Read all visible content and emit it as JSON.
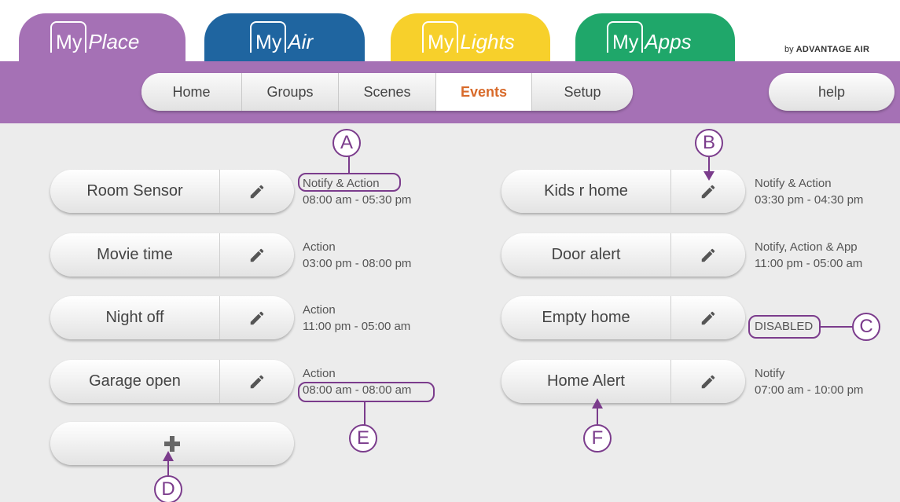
{
  "colors": {
    "myplace": "#a571b5",
    "myair": "#1f65a0",
    "mylights": "#f7d02b",
    "myapps": "#1fa76a",
    "active_tab_text": "#d86a2a",
    "annotation": "#7b3c8c"
  },
  "app_tabs": [
    {
      "prefix": "My",
      "name": "Place"
    },
    {
      "prefix": "My",
      "name": "Air"
    },
    {
      "prefix": "My",
      "name": "Lights"
    },
    {
      "prefix": "My",
      "name": "Apps"
    }
  ],
  "brand": {
    "by": "by",
    "name": "ADVANTAGE AIR"
  },
  "nav": {
    "tabs": [
      "Home",
      "Groups",
      "Scenes",
      "Events",
      "Setup"
    ],
    "active": "Events",
    "help": "help"
  },
  "events_left": [
    {
      "name": "Room Sensor",
      "type": "Notify & Action",
      "time": "08:00 am - 05:30 pm"
    },
    {
      "name": "Movie time",
      "type": "Action",
      "time": "03:00 pm - 08:00 pm"
    },
    {
      "name": "Night off",
      "type": "Action",
      "time": "11:00 pm - 05:00 am"
    },
    {
      "name": "Garage open",
      "type": "Action",
      "time": "08:00 am - 08:00 am"
    }
  ],
  "events_right": [
    {
      "name": "Kids r home",
      "type": "Notify & Action",
      "time": "03:30 pm - 04:30 pm"
    },
    {
      "name": "Door alert",
      "type": "Notify, Action & App",
      "time": "11:00 pm - 05:00 am"
    },
    {
      "name": "Empty home",
      "type": "DISABLED",
      "time": ""
    },
    {
      "name": "Home Alert",
      "type": "Notify",
      "time": "07:00 am - 10:00 pm"
    }
  ],
  "icons": {
    "edit": "pencil-icon",
    "add": "plus-icon"
  },
  "annotations": [
    "A",
    "B",
    "C",
    "D",
    "E",
    "F"
  ]
}
